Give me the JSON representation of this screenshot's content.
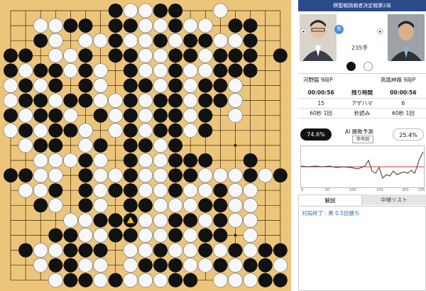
{
  "header": {
    "title": "棋聖戦挑戦者決定戦第2局"
  },
  "players": {
    "black": {
      "name": "河野臨 9段P",
      "turn_badge": "黒"
    },
    "white": {
      "name": "高尾紳路 9段P"
    },
    "move_count": "235手"
  },
  "stats": {
    "rows": [
      [
        "00:00:56",
        "残り時間",
        "00:00:56"
      ],
      [
        "15",
        "アゲハマ",
        "6"
      ],
      [
        "60秒 1回",
        "秒読み",
        "60秒 1回"
      ]
    ]
  },
  "ai": {
    "label": "AI 勝敗予測",
    "black_pct": "74.6%",
    "white_pct": "25.4%",
    "ref_button": "参考図"
  },
  "graph": {
    "axis_labels": [
      "0",
      "50",
      "100",
      "150",
      "200",
      "235"
    ],
    "line_color": "#d93030",
    "curve_color": "#333333"
  },
  "tabs": {
    "commentary": "解説",
    "relay_list": "中継リスト"
  },
  "commentary": {
    "text": "対局終了 : 黒 0.5目勝ち"
  },
  "board": {
    "size": 19,
    "last_move": [
      14,
      8
    ],
    "rows": [
      ".......BWWBB..W....",
      "..WWBB.BBWWBWW.BB..",
      "..BW.WWBWWBWBBWWB..",
      "BB.WWB.BBWWBBWBBB.B",
      "BWBBWBW.BWWBWWBBB..",
      "WBWB.BW.BBWBWBBW...",
      "WBBWBBWWBWBBWBBW...",
      "BWBBW.BWBWBBWB.W...",
      "WBWBBW.WBWBBWB.....",
      ".WBB.WB.BBWB.......",
      "..WWWBW.BWWBBB..B..",
      "BBWW.BWWBWWBBWWWBWB",
      ".WWB.BWBBWWBWWBWW..",
      "..BW.BW.BBWWWBBWW..",
      "....WWBBBWWBBWBWW..",
      "...BBWWBBWWBWBB.W..",
      ".BWWBBB.WWBWWBWBWBB",
      "..WBBWW.WBBBWWBWBBW",
      "...WBBWBWWWBB.WWWBB"
    ]
  }
}
